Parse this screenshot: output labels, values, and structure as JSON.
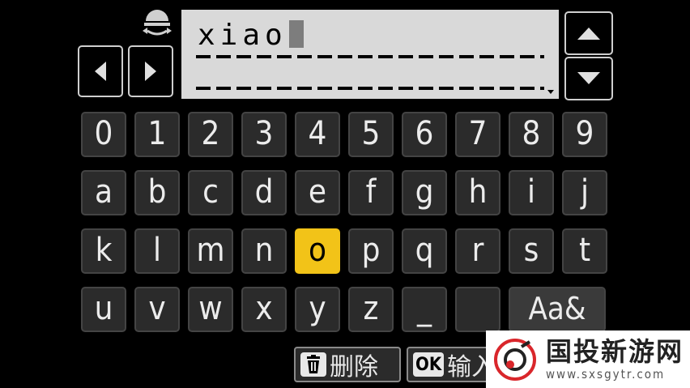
{
  "text_entry": {
    "typed": "xiao"
  },
  "keyboard": {
    "rows": [
      [
        "0",
        "1",
        "2",
        "3",
        "4",
        "5",
        "6",
        "7",
        "8",
        "9"
      ],
      [
        "a",
        "b",
        "c",
        "d",
        "e",
        "f",
        "g",
        "h",
        "i",
        "j"
      ],
      [
        "k",
        "l",
        "m",
        "n",
        "o",
        "p",
        "q",
        "r",
        "s",
        "t"
      ],
      [
        "u",
        "v",
        "w",
        "x",
        "y",
        "z",
        "_",
        ""
      ]
    ],
    "selected_key": "o",
    "mode_key": "Aa&"
  },
  "bottom_bar": {
    "delete_label": "删除",
    "ok_icon": "OK",
    "confirm_label": "输入"
  },
  "watermark": {
    "title": "国投新游网",
    "url": "www.sxsgytr.com"
  },
  "colors": {
    "selected": "#f2c318",
    "key_bg": "#2b2b2b",
    "text_field": "#d9d9d9"
  },
  "icons": [
    "dial-icon",
    "left-arrow-icon",
    "right-arrow-icon",
    "up-arrow-icon",
    "down-arrow-icon",
    "trash-icon"
  ]
}
